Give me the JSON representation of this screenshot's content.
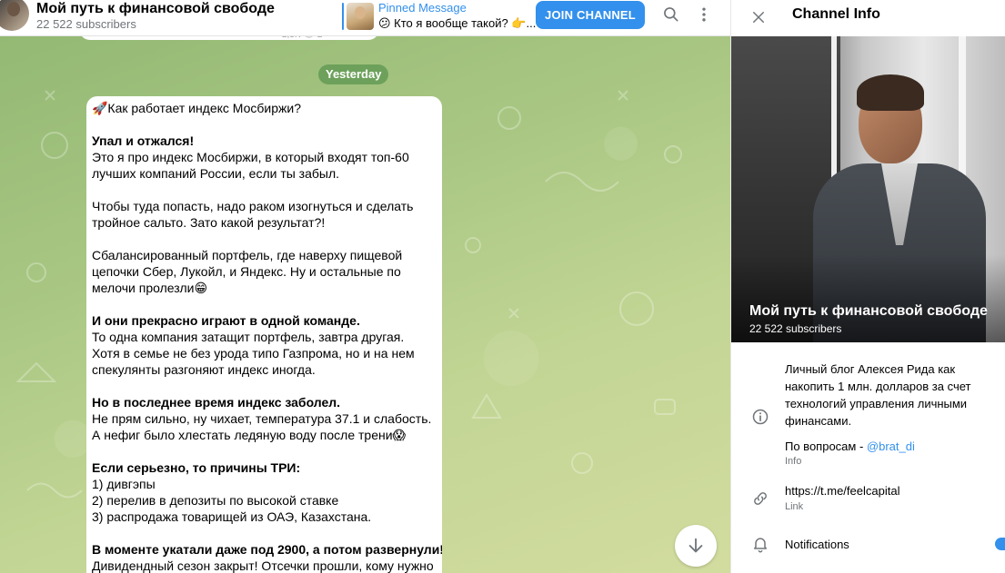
{
  "header": {
    "channel_title": "Мой путь к финансовой свободе",
    "subscribers": "22 522 subscribers",
    "pinned_title": "Pinned Message",
    "pinned_text": "😕 Кто я вообще такой? 👉...",
    "join_label": "JOIN CHANNEL",
    "icons": [
      "search-icon",
      "more-vertical-icon"
    ]
  },
  "chat": {
    "previous_meta": "2,5K 👁 2",
    "date_separator": "Yesterday",
    "message": {
      "title": "🚀Как работает индекс Мосбиржи?",
      "p1_bold": "Упал и отжался!",
      "p1_line1": "Это я про индекс Мосбиржи, в который входят топ-60",
      "p1_line2": "лучших компаний России, если ты забыл.",
      "p2_line1": "Чтобы туда попасть, надо раком изогнуться и сделать",
      "p2_line2": "тройное сальто. Зато какой результат?!",
      "p3_line1": "Сбалансированный портфель, где наверху пищевой",
      "p3_line2": "цепочки Сбер, Лукойл, и Яндекс. Ну и остальные по",
      "p3_line3": "мелочи пролезли😁",
      "p4_bold": "И они прекрасно играют в одной команде.",
      "p4_line1": "То одна компания затащит портфель, завтра другая.",
      "p4_line2": "Хотя в семье не без урода типо Газпрома, но и на нем",
      "p4_line3": "спекулянты разгоняют индекс иногда.",
      "p5_bold": "Но в последнее время индекс заболел.",
      "p5_line1": "Не прям сильно, ну чихает, температура 37.1 и слабость.",
      "p5_line2": "А нефиг было хлестать ледяную воду после трени😱",
      "p6_bold": "Если серьезно, то причины ТРИ:",
      "p6_line1": "1) дивгэпы",
      "p6_line2": "2) перелив в депозиты по высокой ставке",
      "p6_line3": "3) распродажа товарищей из ОАЭ, Казахстана.",
      "p7_bold": "В моменте укатали даже под 2900, а потом развернули!",
      "p7_line1": "Дивидендный сезон закрыт! Отсечки прошли, кому нужно"
    },
    "scroll_down_icon": "arrow-down-icon"
  },
  "info_panel": {
    "title": "Channel Info",
    "cover_title": "Мой путь к финансовой свободе",
    "cover_subscribers": "22 522 subscribers",
    "description_line1": "Личный блог Алексея Рида как",
    "description_line2": "накопить 1 млн. долларов за счет",
    "description_line3": "технологий управления личными",
    "description_line4": "финансами.",
    "contact_prefix": "По вопросам - ",
    "contact_handle": "@brat_di",
    "info_label": "Info",
    "link": "https://t.me/feelcapital",
    "link_label": "Link",
    "notifications_label": "Notifications",
    "notifications_on": true,
    "accent_color": "#3390ec"
  }
}
